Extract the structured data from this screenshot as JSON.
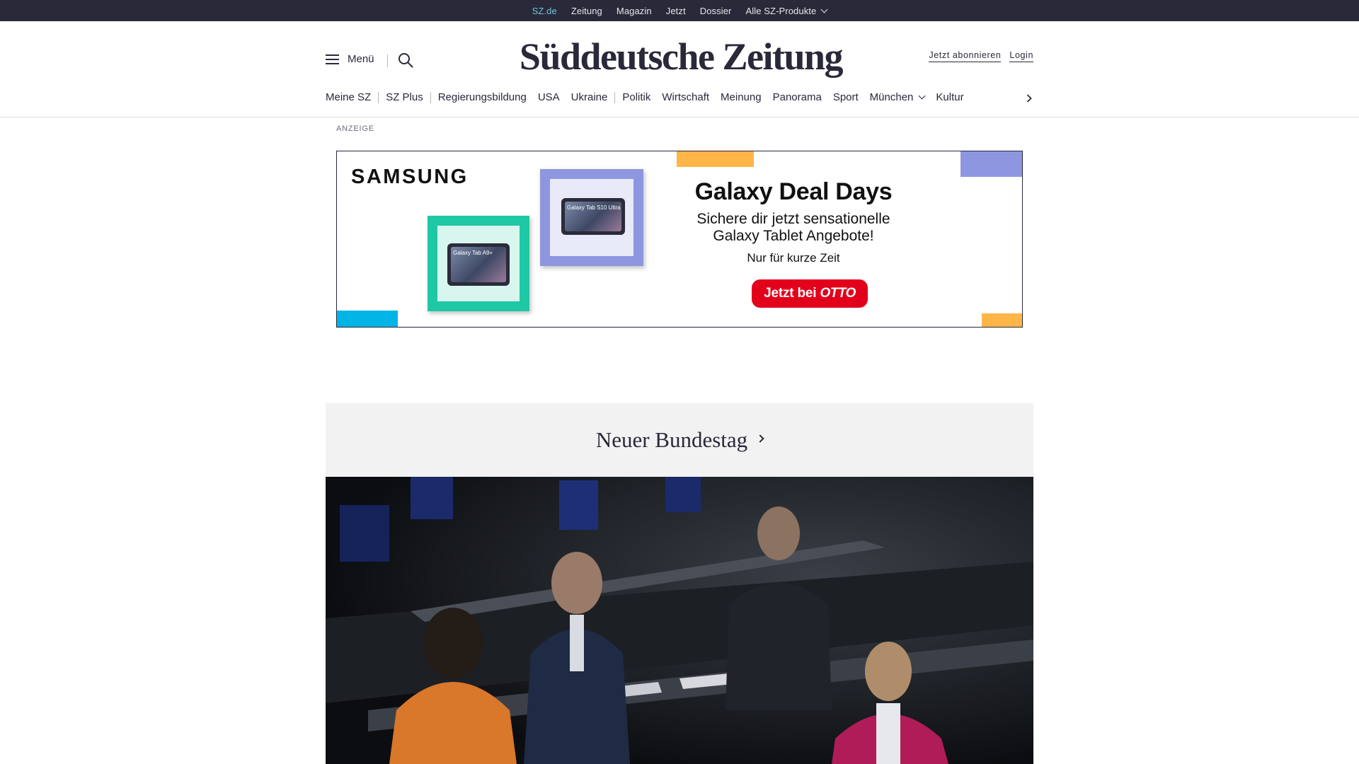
{
  "topbar": {
    "links": [
      "SZ.de",
      "Zeitung",
      "Magazin",
      "Jetzt",
      "Dossier",
      "Alle SZ-Produkte"
    ]
  },
  "header": {
    "menu_label": "Menü",
    "logo": "Süddeutsche Zeitung",
    "subscribe": "Jetzt abonnieren",
    "login": "Login"
  },
  "nav": {
    "items": [
      "Meine SZ",
      "SZ Plus",
      "Regierungsbildung",
      "USA",
      "Ukraine",
      "Politik",
      "Wirtschaft",
      "Meinung",
      "Panorama",
      "Sport",
      "München",
      "Kultur"
    ]
  },
  "ad": {
    "label": "ANZEIGE",
    "brand": "SAMSUNG",
    "tablet1": "Galaxy Tab A9+",
    "tablet2": "Galaxy Tab S10 Ultra",
    "headline": "Galaxy Deal Days",
    "subline1": "Sichere dir jetzt sensationelle",
    "subline2": "Galaxy Tablet Angebote!",
    "small": "Nur für kurze Zeit",
    "cta_prefix": "Jetzt bei",
    "cta_brand": "OTTO"
  },
  "section": {
    "title": "Neuer Bundestag"
  },
  "colors": {
    "topbar_bg": "#29293a",
    "active_link": "#71c7d6",
    "ad_teal": "#1ec8a5",
    "ad_lavender": "#8e96e0",
    "ad_orange": "#ffb547",
    "ad_blue": "#00b4e6",
    "cta_red": "#e3001b"
  }
}
